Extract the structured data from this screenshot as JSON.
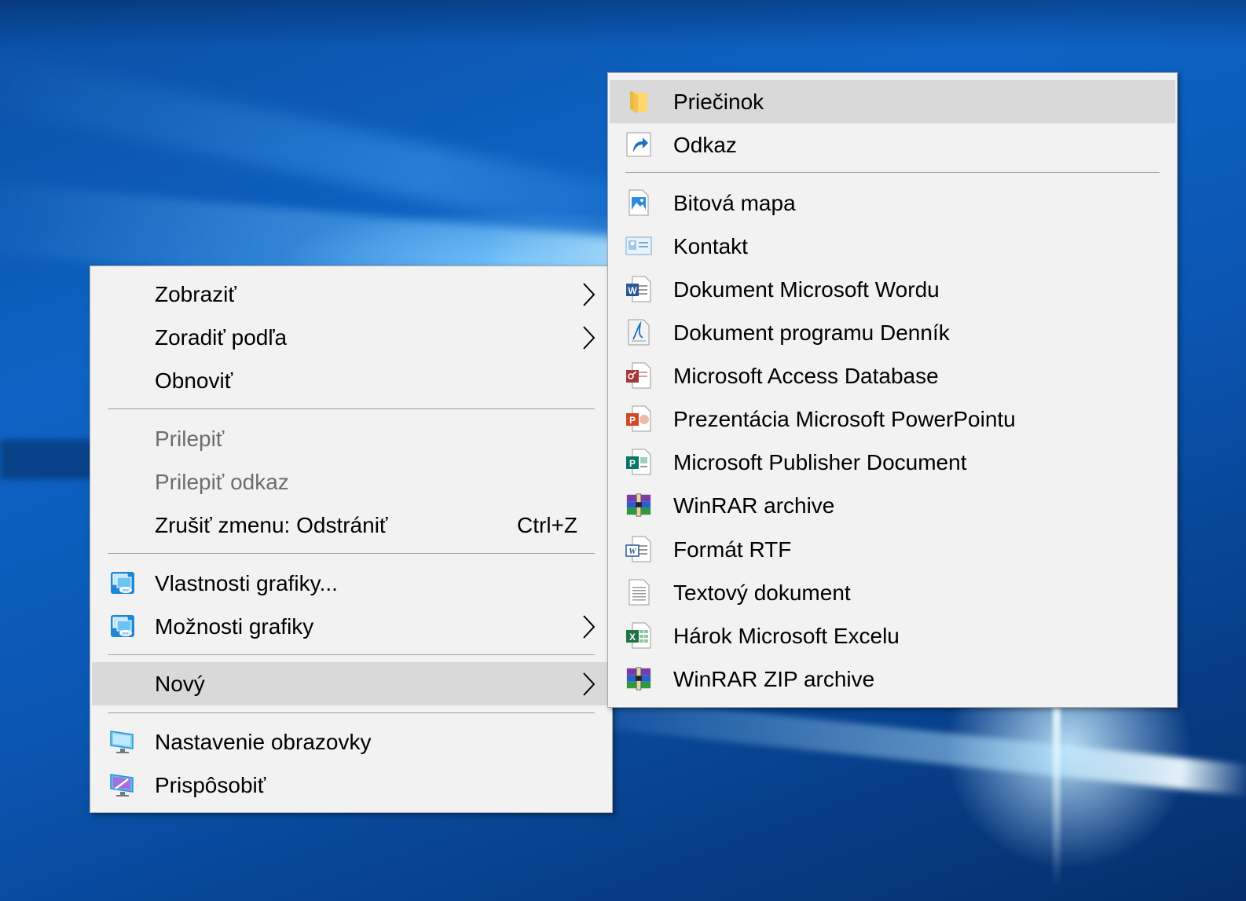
{
  "main_menu": {
    "items": [
      {
        "label": "Zobraziť",
        "has_submenu": true
      },
      {
        "label": "Zoradiť podľa",
        "has_submenu": true
      },
      {
        "label": "Obnoviť"
      },
      {
        "label": "Prilepiť",
        "disabled": true
      },
      {
        "label": "Prilepiť odkaz",
        "disabled": true
      },
      {
        "label": "Zrušiť zmenu: Odstrániť",
        "shortcut": "Ctrl+Z"
      },
      {
        "label": "Vlastnosti grafiky...",
        "icon": "intel-graphics-icon"
      },
      {
        "label": "Možnosti grafiky",
        "icon": "intel-graphics-icon",
        "has_submenu": true
      },
      {
        "label": "Nový",
        "has_submenu": true,
        "highlighted": true
      },
      {
        "label": "Nastavenie obrazovky",
        "icon": "display-settings-icon"
      },
      {
        "label": "Prispôsobiť",
        "icon": "personalize-icon"
      }
    ]
  },
  "sub_menu": {
    "items": [
      {
        "label": "Priečinok",
        "icon": "folder-icon",
        "highlighted": true
      },
      {
        "label": "Odkaz",
        "icon": "shortcut-icon"
      },
      {
        "label": "Bitová mapa",
        "icon": "bitmap-icon"
      },
      {
        "label": "Kontakt",
        "icon": "contact-icon"
      },
      {
        "label": "Dokument Microsoft Wordu",
        "icon": "word-icon"
      },
      {
        "label": "Dokument programu Denník",
        "icon": "journal-icon"
      },
      {
        "label": "Microsoft Access Database",
        "icon": "access-icon"
      },
      {
        "label": "Prezentácia Microsoft PowerPointu",
        "icon": "powerpoint-icon"
      },
      {
        "label": "Microsoft Publisher Document",
        "icon": "publisher-icon"
      },
      {
        "label": "WinRAR archive",
        "icon": "winrar-icon"
      },
      {
        "label": "Formát RTF",
        "icon": "rtf-icon"
      },
      {
        "label": "Textový dokument",
        "icon": "text-document-icon"
      },
      {
        "label": "Hárok Microsoft Excelu",
        "icon": "excel-icon"
      },
      {
        "label": "WinRAR ZIP archive",
        "icon": "winrar-zip-icon"
      }
    ]
  },
  "colors": {
    "menu_bg": "#f2f2f2",
    "highlight": "#d9d9d9",
    "disabled_text": "#6d6d6d",
    "desktop_blue": "#0d63c4"
  }
}
